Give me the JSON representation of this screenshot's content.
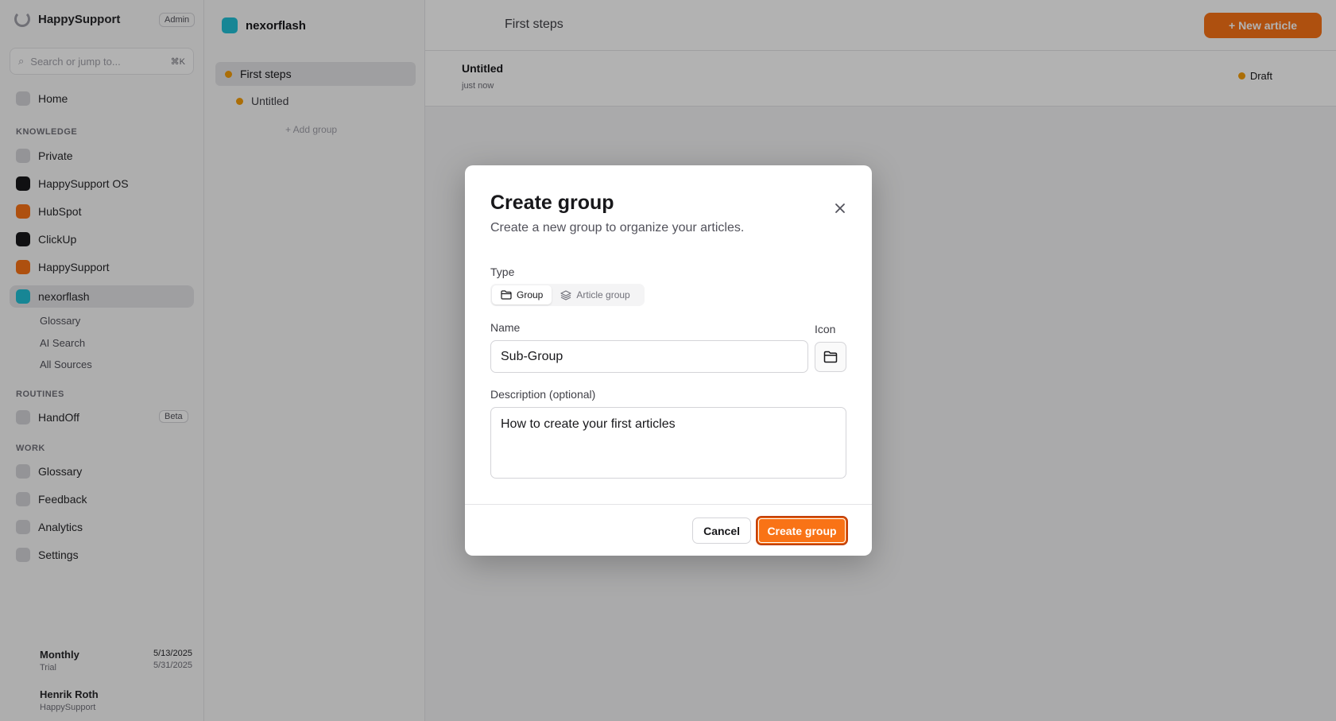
{
  "sidebar": {
    "brand": "HappySupport",
    "brand_badge": "Admin",
    "search_placeholder": "Search or jump to...",
    "search_shortcut": "⌘K",
    "home": "Home",
    "knowledge_label": "KNOWLEDGE",
    "knowledge_items": [
      "Private",
      "HappySupport OS",
      "HubSpot",
      "ClickUp",
      "HappySupport",
      "nexorflash"
    ],
    "nexorflash_sub": [
      "Glossary",
      "AI Search",
      "All Sources"
    ],
    "routines_label": "ROUTINES",
    "routine_item": "HandOff",
    "routine_badge": "Beta",
    "workflows_label": "WORK",
    "work_items": [
      "Glossary",
      "Feedback",
      "Analytics",
      "Settings"
    ],
    "plan": {
      "name": "Monthly",
      "sub": "Trial",
      "right": "5/13/2025",
      "right_sub": "5/31/2025"
    },
    "user": {
      "name": "Henrik Roth",
      "sub": "HappySupport"
    }
  },
  "tree": {
    "title": "nexorflash",
    "active_item": "First steps",
    "child_item": "Untitled",
    "add_group": "+ Add group"
  },
  "main": {
    "breadcrumb": "First steps",
    "new_article": "+ New article",
    "article_title": "Untitled",
    "article_sub": "just now",
    "status": "Draft"
  },
  "modal": {
    "title": "Create group",
    "description": "Create a new group to organize your articles.",
    "type_label": "Type",
    "type_options": [
      "Group",
      "Article group"
    ],
    "name_label": "Name",
    "name_value": "Sub-Group",
    "icon_label": "Icon",
    "description_label": "Description (optional)",
    "description_value": "How to create your first articles",
    "cancel_label": "Cancel",
    "create_label": "Create group"
  },
  "colors": {
    "accent": "#f97316",
    "teal": "#22c1d6"
  }
}
